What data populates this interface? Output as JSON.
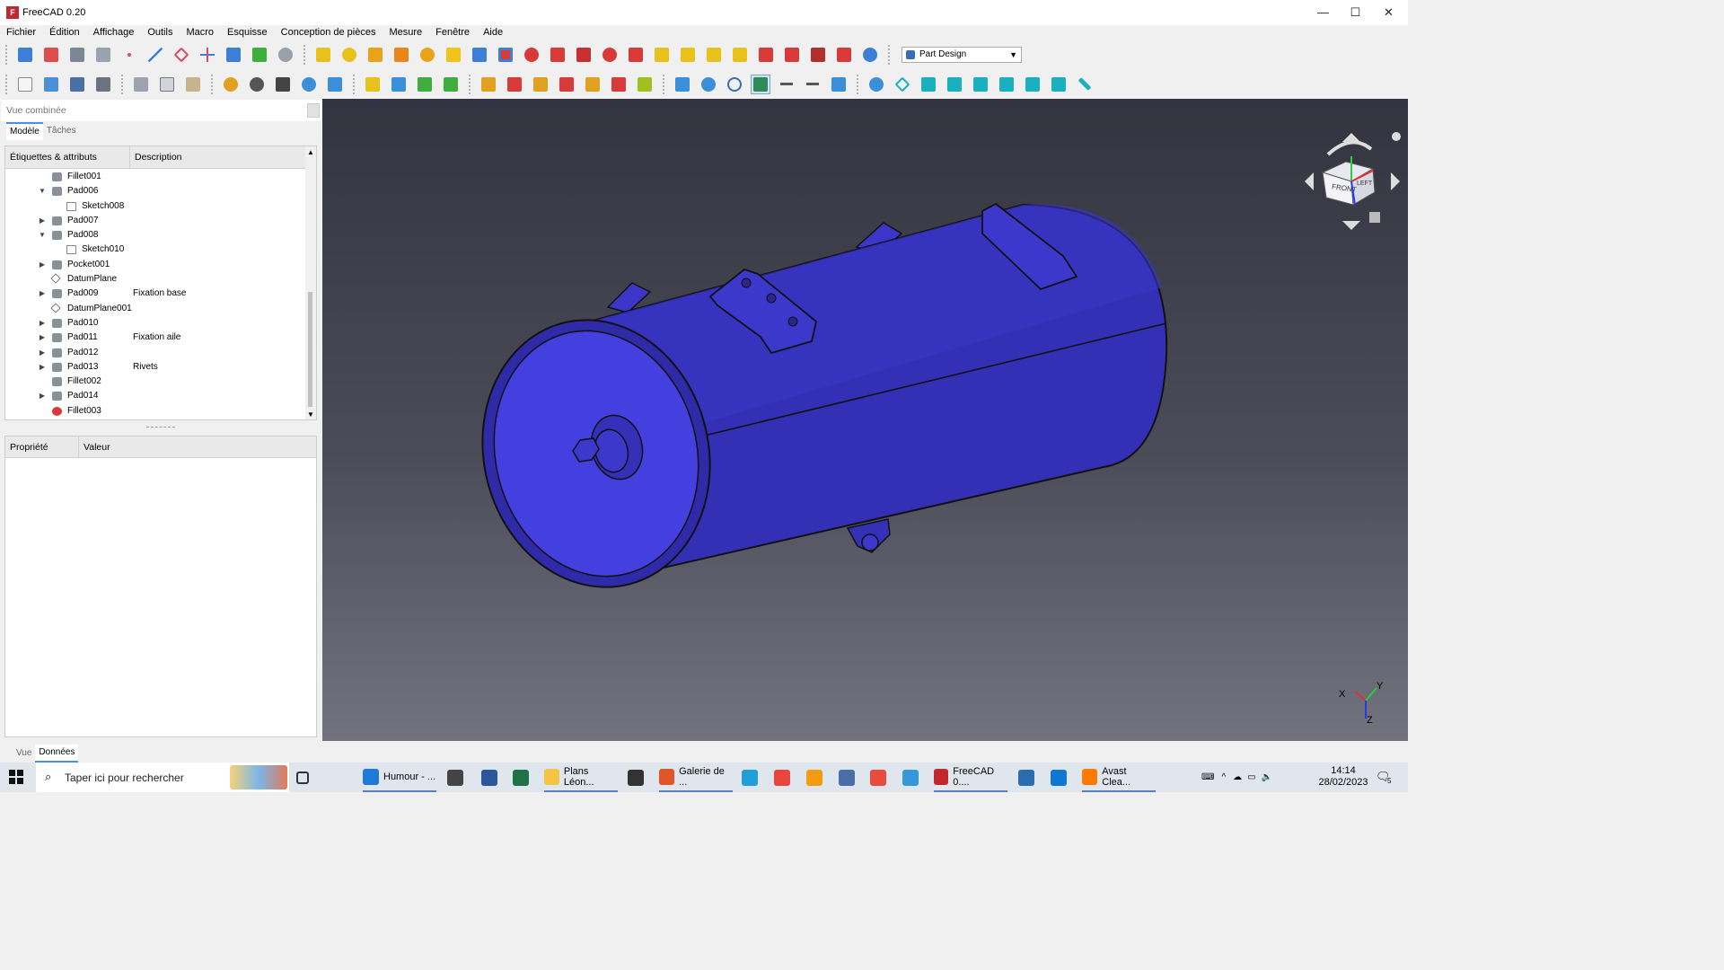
{
  "window": {
    "title": "FreeCAD 0.20",
    "minimize": "—",
    "maximize": "☐",
    "close": "✕"
  },
  "menu": [
    "Fichier",
    "Édition",
    "Affichage",
    "Outils",
    "Macro",
    "Esquisse",
    "Conception de pièces",
    "Mesure",
    "Fenêtre",
    "Aide"
  ],
  "workbench": {
    "selected": "Part Design"
  },
  "combo": {
    "title": "Vue combinée",
    "tabs": [
      "Modèle",
      "Tâches"
    ]
  },
  "tree": {
    "columns": [
      "Étiquettes & attributs",
      "Description"
    ],
    "rows": [
      {
        "label": "Fillet001",
        "desc": "",
        "level": 1,
        "arrow": ""
      },
      {
        "label": "Pad006",
        "desc": "",
        "level": 1,
        "arrow": "v"
      },
      {
        "label": "Sketch008",
        "desc": "",
        "level": 2,
        "arrow": ""
      },
      {
        "label": "Pad007",
        "desc": "",
        "level": 1,
        "arrow": ">"
      },
      {
        "label": "Pad008",
        "desc": "",
        "level": 1,
        "arrow": "v"
      },
      {
        "label": "Sketch010",
        "desc": "",
        "level": 2,
        "arrow": ""
      },
      {
        "label": "Pocket001",
        "desc": "",
        "level": 1,
        "arrow": ">"
      },
      {
        "label": "DatumPlane",
        "desc": "",
        "level": 1,
        "arrow": ""
      },
      {
        "label": "Pad009",
        "desc": "Fixation base",
        "level": 1,
        "arrow": ">"
      },
      {
        "label": "DatumPlane001",
        "desc": "",
        "level": 1,
        "arrow": ""
      },
      {
        "label": "Pad010",
        "desc": "",
        "level": 1,
        "arrow": ">"
      },
      {
        "label": "Pad011",
        "desc": "Fixation aile",
        "level": 1,
        "arrow": ">"
      },
      {
        "label": "Pad012",
        "desc": "",
        "level": 1,
        "arrow": ">"
      },
      {
        "label": "Pad013",
        "desc": "Rivets",
        "level": 1,
        "arrow": ">"
      },
      {
        "label": "Fillet002",
        "desc": "",
        "level": 1,
        "arrow": ""
      },
      {
        "label": "Pad014",
        "desc": "",
        "level": 1,
        "arrow": ">"
      },
      {
        "label": "Fillet003",
        "desc": "",
        "level": 1,
        "arrow": ""
      }
    ]
  },
  "properties": {
    "columns": [
      "Propriété",
      "Valeur"
    ],
    "tabs": [
      "Vue",
      "Données"
    ]
  },
  "navcube": {
    "front": "FRONT",
    "left": "LEFT"
  },
  "axes": {
    "x": "X",
    "y": "Y",
    "z": "Z"
  },
  "taskbar": {
    "search_placeholder": "Taper ici pour rechercher",
    "apps": [
      {
        "name": "Humour - ...",
        "color": "#1f7ad6"
      },
      {
        "name": "",
        "color": "#444"
      },
      {
        "name": "",
        "color": "#2b579a"
      },
      {
        "name": "",
        "color": "#1f7245"
      },
      {
        "name": "Plans Léon...",
        "color": "#f4c542"
      },
      {
        "name": "",
        "color": "#333"
      },
      {
        "name": "Galerie de ...",
        "color": "#e0562a"
      },
      {
        "name": "",
        "color": "#1fa0d8"
      },
      {
        "name": "",
        "color": "#e8453c"
      },
      {
        "name": "",
        "color": "#f39c12"
      },
      {
        "name": "",
        "color": "#4a6fa5"
      },
      {
        "name": "",
        "color": "#e74c3c"
      },
      {
        "name": "",
        "color": "#3498db"
      },
      {
        "name": "FreeCAD 0....",
        "color": "#c0282d"
      },
      {
        "name": "",
        "color": "#2b6cb0"
      },
      {
        "name": "",
        "color": "#0f77d1"
      },
      {
        "name": "Avast Clea...",
        "color": "#ff7a00"
      }
    ],
    "time": "14:14",
    "date": "28/02/2023",
    "notif_count": "5"
  },
  "colors": {
    "model": "#3a35c4",
    "accent": "#4a90e2"
  }
}
